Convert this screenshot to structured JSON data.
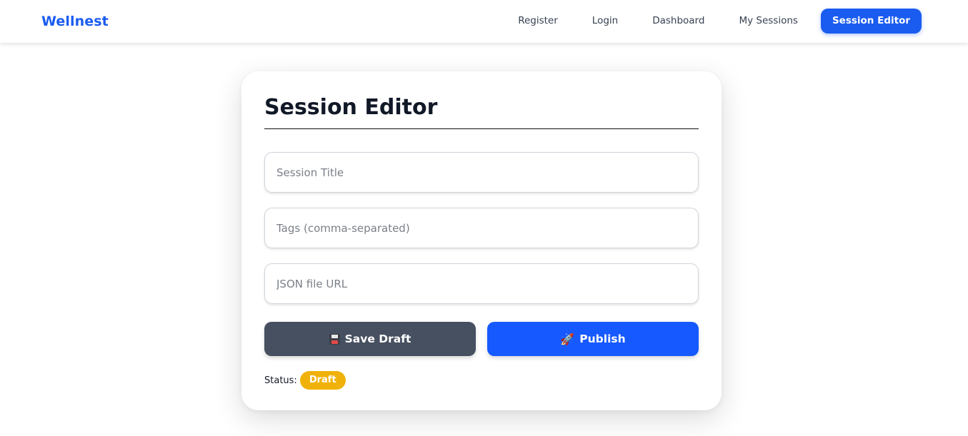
{
  "brand": "Wellnest",
  "nav": [
    {
      "label": "Register",
      "active": false
    },
    {
      "label": "Login",
      "active": false
    },
    {
      "label": "Dashboard",
      "active": false
    },
    {
      "label": "My Sessions",
      "active": false
    },
    {
      "label": "Session Editor",
      "active": true
    }
  ],
  "editor": {
    "heading": "Session Editor",
    "fields": {
      "title_placeholder": "Session Title",
      "tags_placeholder": "Tags (comma-separated)",
      "url_placeholder": "JSON file URL"
    },
    "buttons": {
      "save_draft": {
        "icon": "floppy-disk-icon",
        "label": "Save Draft"
      },
      "publish": {
        "icon": "rocket-icon",
        "glyph": "🚀",
        "label": "Publish"
      }
    },
    "status": {
      "label": "Status:",
      "value": "Draft"
    }
  },
  "colors": {
    "brand": "#1a5cf0",
    "publish": "#1659ff",
    "save_draft": "#475060",
    "badge": "#f0b20a"
  }
}
